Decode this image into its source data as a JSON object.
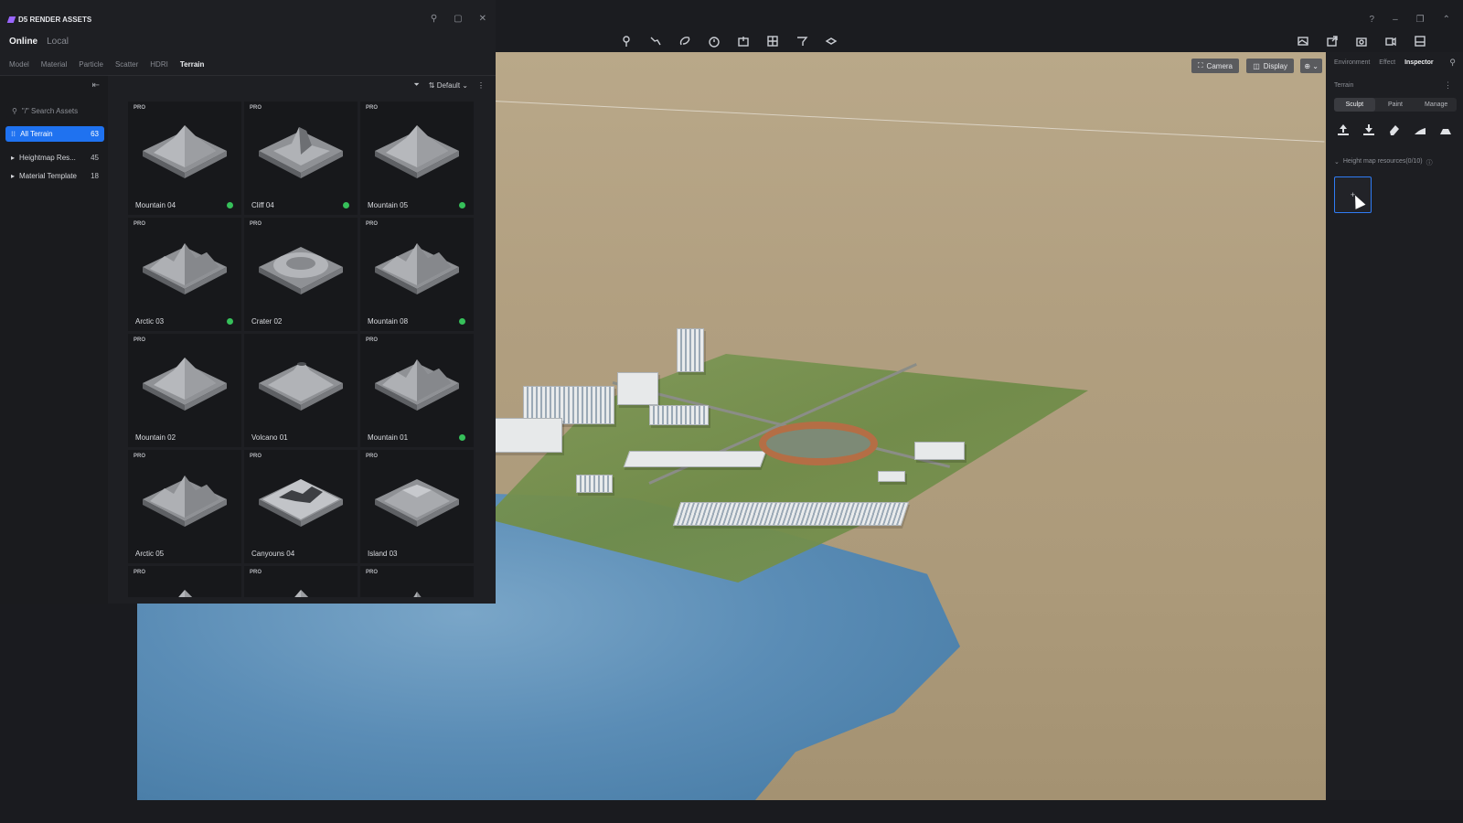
{
  "window": {
    "controls": [
      "?",
      "–",
      "❐",
      "⌃"
    ]
  },
  "toolbar": {
    "center_icons": [
      "marker-icon",
      "path-icon",
      "lasso-icon",
      "timer-icon",
      "export-icon",
      "grid-icon",
      "terrain-brush-icon",
      "layers-icon"
    ],
    "right_icons": [
      "gallery-icon",
      "share-icon",
      "camera-capture-icon",
      "video-icon",
      "render-icon"
    ]
  },
  "viewport": {
    "camera_label": "Camera",
    "display_label": "Display",
    "extra_label": "⊕ ⌄"
  },
  "assets": {
    "title": "D5 RENDER ASSETS",
    "source_online": "Online",
    "source_local": "Local",
    "tabs": [
      "Model",
      "Material",
      "Particle",
      "Scatter",
      "HDRI",
      "Terrain"
    ],
    "active_tab": "Terrain",
    "search_placeholder": "\"/\" Search Assets",
    "sort_label": "Default",
    "sidebar": [
      {
        "label": "All Terrain",
        "count": "63",
        "active": true
      },
      {
        "label": "Heightmap Res...",
        "count": "45",
        "active": false
      },
      {
        "label": "Material Template",
        "count": "18",
        "active": false
      }
    ],
    "items": [
      {
        "name": "Mountain 04",
        "badge": "PRO",
        "downloaded": true,
        "shape": "mountain"
      },
      {
        "name": "Cliff 04",
        "badge": "PRO",
        "downloaded": true,
        "shape": "cliff"
      },
      {
        "name": "Mountain 05",
        "badge": "PRO",
        "downloaded": true,
        "shape": "mountain"
      },
      {
        "name": "Arctic 03",
        "badge": "PRO",
        "downloaded": true,
        "shape": "ridge"
      },
      {
        "name": "Crater 02",
        "badge": "PRO",
        "downloaded": false,
        "shape": "crater"
      },
      {
        "name": "Mountain 08",
        "badge": "PRO",
        "downloaded": true,
        "shape": "ridge"
      },
      {
        "name": "Mountain 02",
        "badge": "PRO",
        "downloaded": false,
        "shape": "mountain"
      },
      {
        "name": "Volcano 01",
        "badge": "",
        "downloaded": false,
        "shape": "volcano"
      },
      {
        "name": "Mountain 01",
        "badge": "PRO",
        "downloaded": true,
        "shape": "ridge"
      },
      {
        "name": "Arctic 05",
        "badge": "PRO",
        "downloaded": false,
        "shape": "ridge"
      },
      {
        "name": "Canyouns 04",
        "badge": "PRO",
        "downloaded": false,
        "shape": "canyon"
      },
      {
        "name": "Island 03",
        "badge": "PRO",
        "downloaded": false,
        "shape": "island"
      },
      {
        "name": "",
        "badge": "PRO",
        "downloaded": false,
        "shape": "mountain"
      },
      {
        "name": "",
        "badge": "PRO",
        "downloaded": false,
        "shape": "mountain"
      },
      {
        "name": "",
        "badge": "PRO",
        "downloaded": false,
        "shape": "ridge"
      }
    ]
  },
  "inspector": {
    "tabs": [
      "Environment",
      "Effect",
      "Inspector"
    ],
    "active_tab": "Inspector",
    "section": "Terrain",
    "modes": [
      "Sculpt",
      "Paint",
      "Manage"
    ],
    "active_mode": "Sculpt",
    "tools": [
      "raise-icon",
      "lower-icon",
      "eraser-icon",
      "smooth-icon",
      "flatten-icon"
    ],
    "heightmap_label": "Height map resources(0/10)",
    "add_slot": "+"
  },
  "colors": {
    "accent": "#1f72f0",
    "downloaded": "#36c05a",
    "sand": "#b19f80",
    "water": "#5b8db6",
    "grass": "#6f8b48"
  }
}
